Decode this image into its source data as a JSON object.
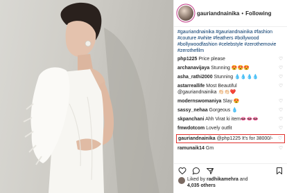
{
  "header": {
    "username": "gauriandnainika",
    "separator": "•",
    "follow_label": "Following"
  },
  "caption": {
    "hashtags": "#gauriandnainika #gauriandnainika #fashion #couture #white #feathers #bollywood #bollywoodfashion #celebstyle #zerothemovie #zerothefilm"
  },
  "comments": [
    {
      "user": "php1225",
      "text": "Price please"
    },
    {
      "user": "archanavijaya",
      "text": "Stunning 😍😍😍"
    },
    {
      "user": "asha_rathi2000",
      "text": "Stunning 💧💧💧💧"
    },
    {
      "user": "astarreallife",
      "text": "Most Beautiful @gauriandnainika 👏🏻👏🏻❤️"
    },
    {
      "user": "modernswomaniya",
      "text": "Slay 😍"
    },
    {
      "user": "sassy_nehaa",
      "text": "Gorgeous 💧"
    },
    {
      "user": "skpanchani",
      "text": "Ahh Virat ki item👄👄👄"
    },
    {
      "user": "fmwdotcom",
      "text": "Lovely outfit"
    },
    {
      "user": "gauriandnainika",
      "text": "@php1225 It's for 38000/-"
    },
    {
      "user": "ramunaik14",
      "text": "Gm"
    }
  ],
  "likes": {
    "prefix": "Liked by ",
    "user": "radhikamehra",
    "middle": " and",
    "others": "4,035 others"
  },
  "icons": [
    "heart-icon",
    "comment-icon",
    "share-icon",
    "bookmark-icon"
  ],
  "colors": {
    "highlight": "#e0302b",
    "hashtag": "#003569",
    "avatar_ring": "#c13584"
  }
}
